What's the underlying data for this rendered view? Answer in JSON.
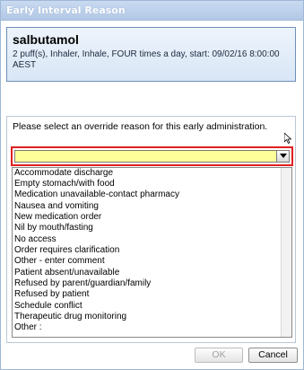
{
  "window": {
    "title": "Early Interval Reason"
  },
  "medication": {
    "name": "salbutamol",
    "detail": "2 puff(s), Inhaler, Inhale, FOUR times a day, start: 09/02/16 8:00:00 AEST"
  },
  "override": {
    "prompt": "Please select an override reason for this early administration.",
    "selected_value": "",
    "options": [
      "Accommodate discharge",
      "Empty stomach/with food",
      "Medication unavailable-contact pharmacy",
      "Nausea and vomiting",
      "New medication order",
      "Nil by mouth/fasting",
      "No access",
      "Order requires clarification",
      "Other - enter comment",
      "Patient absent/unavailable",
      "Refused by parent/guardian/family",
      "Refused by patient",
      "Schedule conflict",
      "Therapeutic drug monitoring",
      "Other :"
    ]
  },
  "buttons": {
    "ok_label": "OK",
    "cancel_label": "Cancel"
  },
  "colors": {
    "combo_highlight": "#ffff99",
    "focus_outline": "#e02020",
    "title_bar": "#b3c8e6"
  },
  "icons": {
    "combo_arrow": "chevron-down-icon",
    "pointer": "mouse-cursor-icon"
  }
}
